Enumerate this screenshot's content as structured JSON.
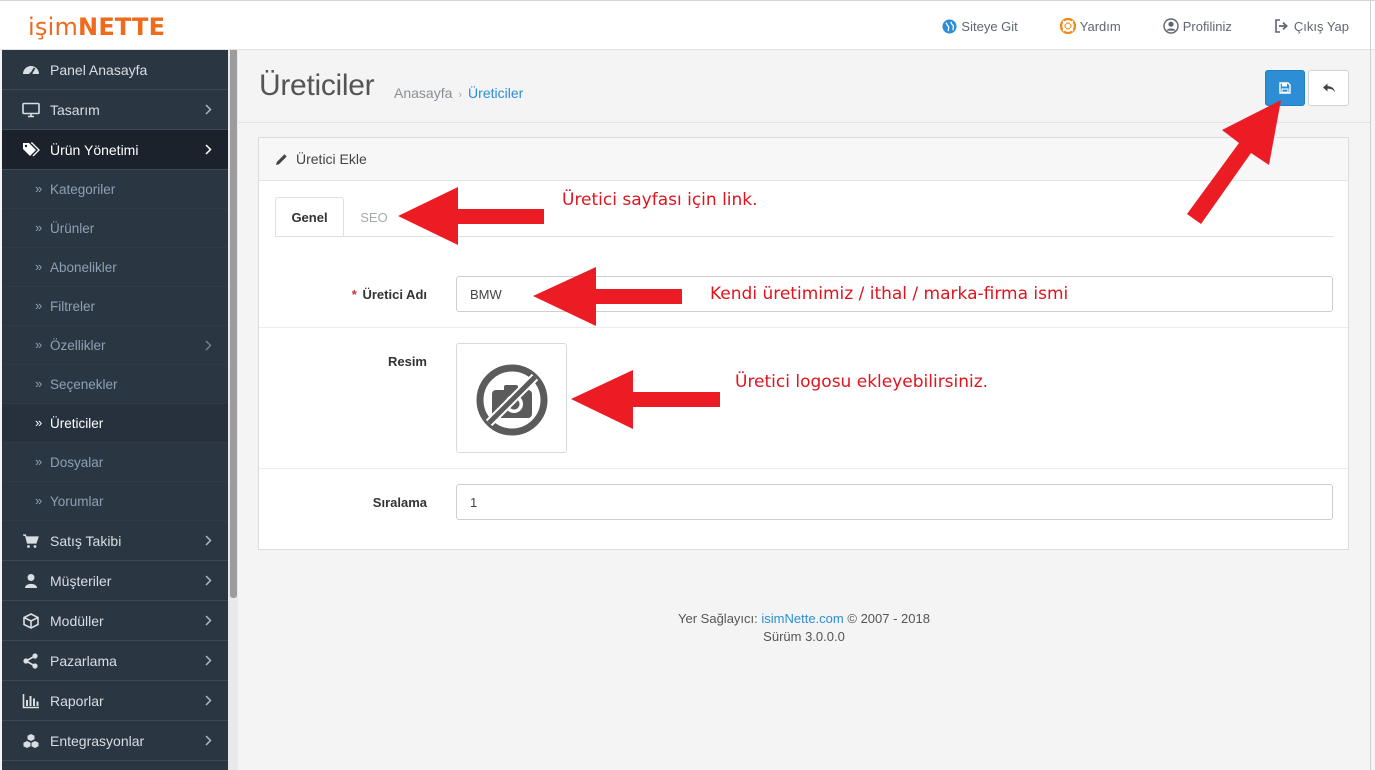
{
  "brand": {
    "prefix": "işim",
    "suffix": "NETTE"
  },
  "topnav": {
    "site": "Siteye Git",
    "help": "Yardım",
    "profile": "Profiliniz",
    "logout": "Çıkış Yap"
  },
  "sidebar": {
    "items": [
      {
        "label": "Panel Anasayfa",
        "icon": "dashboard-icon"
      },
      {
        "label": "Tasarım",
        "icon": "monitor-icon"
      },
      {
        "label": "Ürün Yönetimi",
        "icon": "tags-icon"
      }
    ],
    "subitems": [
      "Kategoriler",
      "Ürünler",
      "Abonelikler",
      "Filtreler",
      "Özellikler",
      "Seçenekler",
      "Üreticiler",
      "Dosyalar",
      "Yorumlar"
    ],
    "bottom_items": [
      {
        "label": "Satış Takibi",
        "icon": "cart-icon"
      },
      {
        "label": "Müşteriler",
        "icon": "user-icon"
      },
      {
        "label": "Modüller",
        "icon": "cube-icon"
      },
      {
        "label": "Pazarlama",
        "icon": "share-icon"
      },
      {
        "label": "Raporlar",
        "icon": "bar-chart-icon"
      },
      {
        "label": "Entegrasyonlar",
        "icon": "cubes-icon"
      }
    ]
  },
  "page": {
    "title": "Üreticiler",
    "breadcrumb": [
      "Anasayfa",
      "Üreticiler"
    ]
  },
  "panel": {
    "title": "Üretici Ekle",
    "tabs": [
      "Genel",
      "SEO"
    ]
  },
  "form": {
    "name_required": "*",
    "name_label": "Üretici Adı",
    "name_value": "BMW",
    "image_label": "Resim",
    "sort_label": "Sıralama",
    "sort_value": "1"
  },
  "footer": {
    "provider_prefix": "Yer Sağlayıcı:",
    "provider_link": "isimNette.com",
    "provider_suffix": "© 2007 - 2018",
    "version": "Sürüm 3.0.0.0"
  },
  "annotations": {
    "seo_note": "Üretici sayfası için link.",
    "name_note": "Kendi üretimimiz / ithal / marka-firma ismi",
    "logo_note": "Üretici logosu ekleyebilirsiniz.",
    "color": "#e0141e"
  },
  "colors": {
    "brand": "#ef6a1a",
    "sidebar": "#2b3643",
    "accent": "#2d8ed6"
  }
}
